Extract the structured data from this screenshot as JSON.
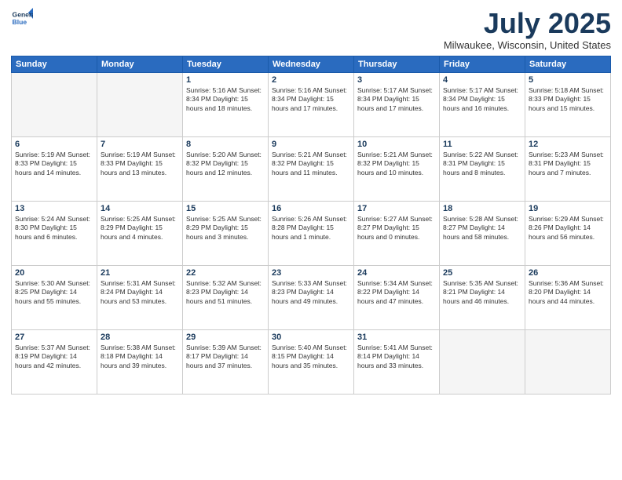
{
  "header": {
    "logo_line1": "General",
    "logo_line2": "Blue",
    "title": "July 2025",
    "location": "Milwaukee, Wisconsin, United States"
  },
  "weekdays": [
    "Sunday",
    "Monday",
    "Tuesday",
    "Wednesday",
    "Thursday",
    "Friday",
    "Saturday"
  ],
  "weeks": [
    [
      {
        "day": "",
        "text": ""
      },
      {
        "day": "",
        "text": ""
      },
      {
        "day": "1",
        "text": "Sunrise: 5:16 AM\nSunset: 8:34 PM\nDaylight: 15 hours\nand 18 minutes."
      },
      {
        "day": "2",
        "text": "Sunrise: 5:16 AM\nSunset: 8:34 PM\nDaylight: 15 hours\nand 17 minutes."
      },
      {
        "day": "3",
        "text": "Sunrise: 5:17 AM\nSunset: 8:34 PM\nDaylight: 15 hours\nand 17 minutes."
      },
      {
        "day": "4",
        "text": "Sunrise: 5:17 AM\nSunset: 8:34 PM\nDaylight: 15 hours\nand 16 minutes."
      },
      {
        "day": "5",
        "text": "Sunrise: 5:18 AM\nSunset: 8:33 PM\nDaylight: 15 hours\nand 15 minutes."
      }
    ],
    [
      {
        "day": "6",
        "text": "Sunrise: 5:19 AM\nSunset: 8:33 PM\nDaylight: 15 hours\nand 14 minutes."
      },
      {
        "day": "7",
        "text": "Sunrise: 5:19 AM\nSunset: 8:33 PM\nDaylight: 15 hours\nand 13 minutes."
      },
      {
        "day": "8",
        "text": "Sunrise: 5:20 AM\nSunset: 8:32 PM\nDaylight: 15 hours\nand 12 minutes."
      },
      {
        "day": "9",
        "text": "Sunrise: 5:21 AM\nSunset: 8:32 PM\nDaylight: 15 hours\nand 11 minutes."
      },
      {
        "day": "10",
        "text": "Sunrise: 5:21 AM\nSunset: 8:32 PM\nDaylight: 15 hours\nand 10 minutes."
      },
      {
        "day": "11",
        "text": "Sunrise: 5:22 AM\nSunset: 8:31 PM\nDaylight: 15 hours\nand 8 minutes."
      },
      {
        "day": "12",
        "text": "Sunrise: 5:23 AM\nSunset: 8:31 PM\nDaylight: 15 hours\nand 7 minutes."
      }
    ],
    [
      {
        "day": "13",
        "text": "Sunrise: 5:24 AM\nSunset: 8:30 PM\nDaylight: 15 hours\nand 6 minutes."
      },
      {
        "day": "14",
        "text": "Sunrise: 5:25 AM\nSunset: 8:29 PM\nDaylight: 15 hours\nand 4 minutes."
      },
      {
        "day": "15",
        "text": "Sunrise: 5:25 AM\nSunset: 8:29 PM\nDaylight: 15 hours\nand 3 minutes."
      },
      {
        "day": "16",
        "text": "Sunrise: 5:26 AM\nSunset: 8:28 PM\nDaylight: 15 hours\nand 1 minute."
      },
      {
        "day": "17",
        "text": "Sunrise: 5:27 AM\nSunset: 8:27 PM\nDaylight: 15 hours\nand 0 minutes."
      },
      {
        "day": "18",
        "text": "Sunrise: 5:28 AM\nSunset: 8:27 PM\nDaylight: 14 hours\nand 58 minutes."
      },
      {
        "day": "19",
        "text": "Sunrise: 5:29 AM\nSunset: 8:26 PM\nDaylight: 14 hours\nand 56 minutes."
      }
    ],
    [
      {
        "day": "20",
        "text": "Sunrise: 5:30 AM\nSunset: 8:25 PM\nDaylight: 14 hours\nand 55 minutes."
      },
      {
        "day": "21",
        "text": "Sunrise: 5:31 AM\nSunset: 8:24 PM\nDaylight: 14 hours\nand 53 minutes."
      },
      {
        "day": "22",
        "text": "Sunrise: 5:32 AM\nSunset: 8:23 PM\nDaylight: 14 hours\nand 51 minutes."
      },
      {
        "day": "23",
        "text": "Sunrise: 5:33 AM\nSunset: 8:23 PM\nDaylight: 14 hours\nand 49 minutes."
      },
      {
        "day": "24",
        "text": "Sunrise: 5:34 AM\nSunset: 8:22 PM\nDaylight: 14 hours\nand 47 minutes."
      },
      {
        "day": "25",
        "text": "Sunrise: 5:35 AM\nSunset: 8:21 PM\nDaylight: 14 hours\nand 46 minutes."
      },
      {
        "day": "26",
        "text": "Sunrise: 5:36 AM\nSunset: 8:20 PM\nDaylight: 14 hours\nand 44 minutes."
      }
    ],
    [
      {
        "day": "27",
        "text": "Sunrise: 5:37 AM\nSunset: 8:19 PM\nDaylight: 14 hours\nand 42 minutes."
      },
      {
        "day": "28",
        "text": "Sunrise: 5:38 AM\nSunset: 8:18 PM\nDaylight: 14 hours\nand 39 minutes."
      },
      {
        "day": "29",
        "text": "Sunrise: 5:39 AM\nSunset: 8:17 PM\nDaylight: 14 hours\nand 37 minutes."
      },
      {
        "day": "30",
        "text": "Sunrise: 5:40 AM\nSunset: 8:15 PM\nDaylight: 14 hours\nand 35 minutes."
      },
      {
        "day": "31",
        "text": "Sunrise: 5:41 AM\nSunset: 8:14 PM\nDaylight: 14 hours\nand 33 minutes."
      },
      {
        "day": "",
        "text": ""
      },
      {
        "day": "",
        "text": ""
      }
    ]
  ]
}
